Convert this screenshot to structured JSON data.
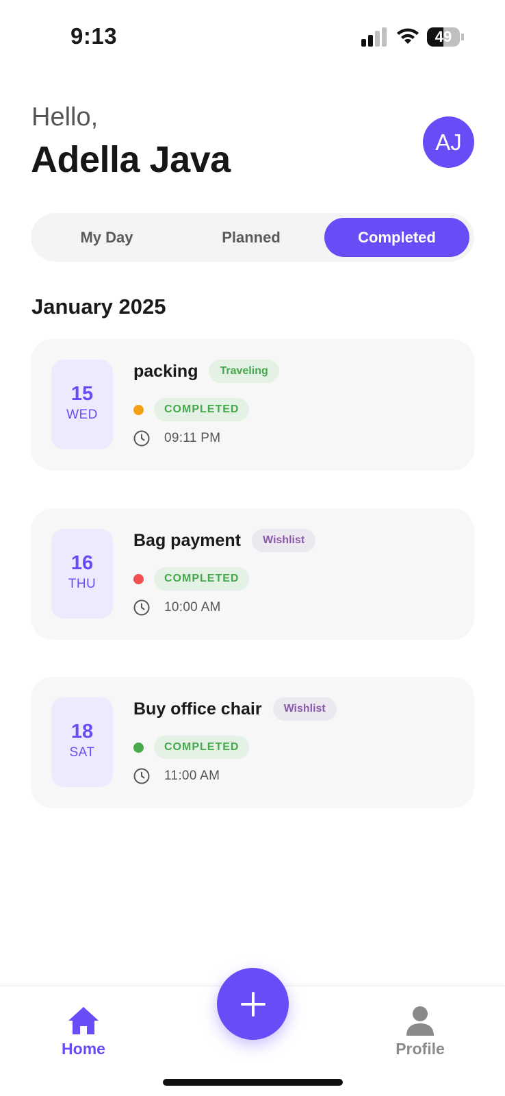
{
  "status_bar": {
    "time": "9:13",
    "battery": "49",
    "battery_level": 0.49
  },
  "header": {
    "greeting": "Hello,",
    "user_name": "Adella Java",
    "avatar_initials": "AJ"
  },
  "tabs": [
    {
      "label": "My Day",
      "active": false
    },
    {
      "label": "Planned",
      "active": false
    },
    {
      "label": "Completed",
      "active": true
    }
  ],
  "month_heading": "January 2025",
  "tasks": [
    {
      "day": "15",
      "weekday": "WED",
      "title": "packing",
      "category": "Traveling",
      "status": "COMPLETED",
      "time": "09:11 PM",
      "priority_color": "#f5a012"
    },
    {
      "day": "16",
      "weekday": "THU",
      "title": "Bag payment",
      "category": "Wishlist",
      "status": "COMPLETED",
      "time": "10:00 AM",
      "priority_color": "#f04f4f"
    },
    {
      "day": "18",
      "weekday": "SAT",
      "title": "Buy office chair",
      "category": "Wishlist",
      "status": "COMPLETED",
      "time": "11:00 AM",
      "priority_color": "#46ab4d"
    }
  ],
  "category_styles": {
    "Traveling": {
      "bg": "#e3f2e4",
      "fg": "#45a64b"
    },
    "Wishlist": {
      "bg": "#ece8f0",
      "fg": "#8a5aa8"
    }
  },
  "bottom_nav": {
    "home_label": "Home",
    "profile_label": "Profile",
    "add_icon": "plus-icon"
  },
  "colors": {
    "accent": "#6a4cf6",
    "completed_green": "#45a64b"
  }
}
